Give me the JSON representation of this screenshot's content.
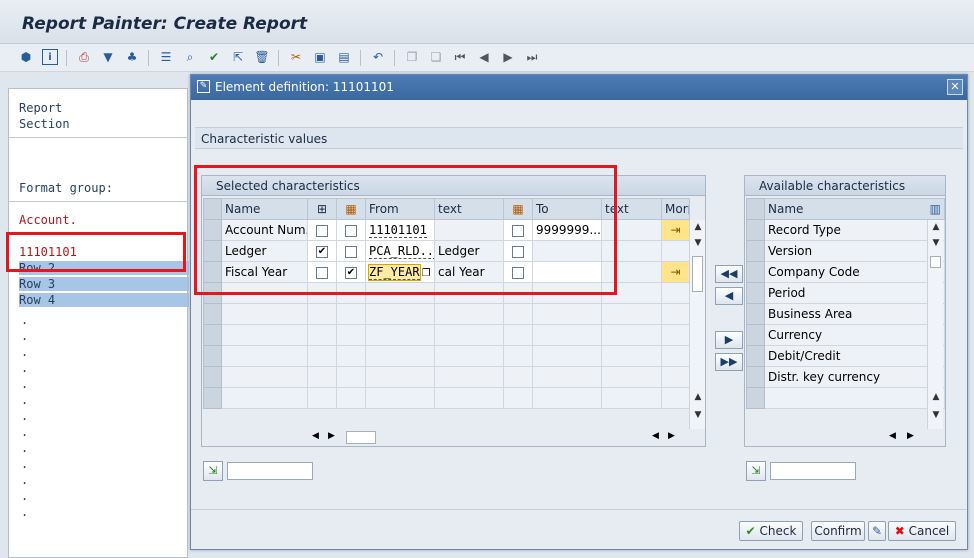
{
  "app": {
    "title": "Report Painter: Create Report"
  },
  "toolbar": {
    "icons": [
      "hierarchy-icon",
      "info-icon",
      "print-icon",
      "filter-icon",
      "structure-icon",
      "sep",
      "list-icon",
      "find-icon",
      "check-icon",
      "pointer-icon",
      "delete-icon",
      "sep",
      "cut-icon",
      "format-icon",
      "paste-icon",
      "sep",
      "undo-icon",
      "sep",
      "copy-icon",
      "paste2-icon",
      "first-icon",
      "prev-icon",
      "next-icon",
      "last-icon"
    ]
  },
  "left": {
    "report": "Report",
    "section": "Section",
    "format_group": "Format group:",
    "account": "Account.",
    "rows": [
      "11101101",
      "Row 2",
      "Row 3",
      "Row 4"
    ],
    "dots": [
      ".",
      ".",
      ".",
      ".",
      ".",
      ".",
      ".",
      ".",
      ".",
      ".",
      ".",
      ".",
      "."
    ]
  },
  "dialog": {
    "title": "Element definition: 11101101",
    "section": "Characteristic values",
    "selected": {
      "title": "Selected characteristics",
      "columns": {
        "name": "Name",
        "from": "From",
        "text1": "text",
        "to": "To",
        "text2": "text",
        "more": "Mor"
      },
      "rows": [
        {
          "name": "Account Num...",
          "c1": false,
          "c2": false,
          "from": "11101101",
          "text": "",
          "c3": false,
          "to": "9999999...",
          "text2": ""
        },
        {
          "name": "Ledger",
          "c1": true,
          "c2": false,
          "from": "PCA_RLD...",
          "text": "Ledger",
          "c3": false,
          "to": "",
          "text2": ""
        },
        {
          "name": "Fiscal Year",
          "c1": false,
          "c2": true,
          "from": "ZF_YEAR",
          "text": "cal Year",
          "c3": false,
          "to": "",
          "text2": ""
        }
      ]
    },
    "available": {
      "title": "Available characteristics",
      "column": "Name",
      "items": [
        "Record Type",
        "Version",
        "Company Code",
        "Period",
        "Business Area",
        "Currency",
        "Debit/Credit",
        "Distr. key currency"
      ]
    },
    "buttons": {
      "check": "Check",
      "confirm": "Confirm",
      "cancel": "Cancel"
    }
  },
  "colors": {
    "title_bar": "#3a679e",
    "highlight_box": "#e5161c",
    "selected_row": "#a9c5e6"
  }
}
